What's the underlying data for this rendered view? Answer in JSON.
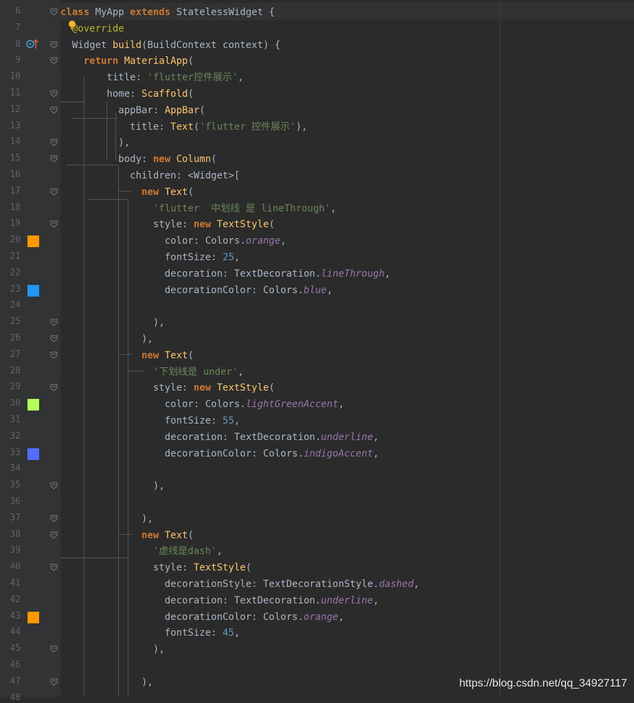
{
  "editor": {
    "lines": [
      {
        "n": "6",
        "tokens": [
          [
            "kw",
            "class "
          ],
          [
            "plain",
            "MyApp "
          ],
          [
            "kw",
            "extends "
          ],
          [
            "plain",
            "StatelessWidget {"
          ]
        ]
      },
      {
        "n": "7",
        "tokens": [
          [
            "anno",
            "  @override"
          ]
        ]
      },
      {
        "n": "8",
        "tokens": [
          [
            "plain",
            "  Widget "
          ],
          [
            "cls",
            "build"
          ],
          [
            "plain",
            "(BuildContext context) {"
          ]
        ]
      },
      {
        "n": "9",
        "tokens": [
          [
            "kw",
            "    return "
          ],
          [
            "cls",
            "MaterialApp"
          ],
          [
            "plain",
            "("
          ]
        ]
      },
      {
        "n": "10",
        "tokens": [
          [
            "plain",
            "        title: "
          ],
          [
            "str",
            "'flutter控件展示'"
          ],
          [
            "plain",
            ","
          ]
        ]
      },
      {
        "n": "11",
        "tokens": [
          [
            "plain",
            "        home: "
          ],
          [
            "cls",
            "Scaffold"
          ],
          [
            "plain",
            "("
          ]
        ]
      },
      {
        "n": "12",
        "tokens": [
          [
            "plain",
            "          appBar: "
          ],
          [
            "cls",
            "AppBar"
          ],
          [
            "plain",
            "("
          ]
        ]
      },
      {
        "n": "13",
        "tokens": [
          [
            "plain",
            "            title: "
          ],
          [
            "cls",
            "Text"
          ],
          [
            "plain",
            "("
          ],
          [
            "str",
            "'flutter 控件展示'"
          ],
          [
            "plain",
            "),"
          ]
        ]
      },
      {
        "n": "14",
        "tokens": [
          [
            "plain",
            "          ),"
          ]
        ]
      },
      {
        "n": "15",
        "tokens": [
          [
            "plain",
            "          body: "
          ],
          [
            "kw",
            "new "
          ],
          [
            "cls",
            "Column"
          ],
          [
            "plain",
            "("
          ]
        ]
      },
      {
        "n": "16",
        "tokens": [
          [
            "plain",
            "            children: <Widget>["
          ]
        ]
      },
      {
        "n": "17",
        "tokens": [
          [
            "kw",
            "              new "
          ],
          [
            "cls",
            "Text"
          ],
          [
            "plain",
            "("
          ]
        ]
      },
      {
        "n": "18",
        "tokens": [
          [
            "str",
            "                'flutter  中划线 是 lineThrough'"
          ],
          [
            "plain",
            ","
          ]
        ]
      },
      {
        "n": "19",
        "tokens": [
          [
            "plain",
            "                style: "
          ],
          [
            "kw",
            "new "
          ],
          [
            "cls",
            "TextStyle"
          ],
          [
            "plain",
            "("
          ]
        ]
      },
      {
        "n": "20",
        "tokens": [
          [
            "plain",
            "                  color: Colors."
          ],
          [
            "field",
            "orange"
          ],
          [
            "plain",
            ","
          ]
        ]
      },
      {
        "n": "21",
        "tokens": [
          [
            "plain",
            "                  fontSize: "
          ],
          [
            "num",
            "25"
          ],
          [
            "plain",
            ","
          ]
        ]
      },
      {
        "n": "22",
        "tokens": [
          [
            "plain",
            "                  decoration: TextDecoration."
          ],
          [
            "field",
            "lineThrough"
          ],
          [
            "plain",
            ","
          ]
        ]
      },
      {
        "n": "23",
        "tokens": [
          [
            "plain",
            "                  decorationColor: Colors."
          ],
          [
            "field",
            "blue"
          ],
          [
            "plain",
            ","
          ]
        ]
      },
      {
        "n": "24",
        "tokens": []
      },
      {
        "n": "25",
        "tokens": [
          [
            "plain",
            "                ),"
          ]
        ]
      },
      {
        "n": "26",
        "tokens": [
          [
            "plain",
            "              ),"
          ]
        ]
      },
      {
        "n": "27",
        "tokens": [
          [
            "kw",
            "              new "
          ],
          [
            "cls",
            "Text"
          ],
          [
            "plain",
            "("
          ]
        ]
      },
      {
        "n": "28",
        "tokens": [
          [
            "str",
            "                '下划线是 under'"
          ],
          [
            "plain",
            ","
          ]
        ]
      },
      {
        "n": "29",
        "tokens": [
          [
            "plain",
            "                style: "
          ],
          [
            "kw",
            "new "
          ],
          [
            "cls",
            "TextStyle"
          ],
          [
            "plain",
            "("
          ]
        ]
      },
      {
        "n": "30",
        "tokens": [
          [
            "plain",
            "                  color: Colors."
          ],
          [
            "field",
            "lightGreenAccent"
          ],
          [
            "plain",
            ","
          ]
        ]
      },
      {
        "n": "31",
        "tokens": [
          [
            "plain",
            "                  fontSize: "
          ],
          [
            "num",
            "55"
          ],
          [
            "plain",
            ","
          ]
        ]
      },
      {
        "n": "32",
        "tokens": [
          [
            "plain",
            "                  decoration: TextDecoration."
          ],
          [
            "field",
            "underline"
          ],
          [
            "plain",
            ","
          ]
        ]
      },
      {
        "n": "33",
        "tokens": [
          [
            "plain",
            "                  decorationColor: Colors."
          ],
          [
            "field",
            "indigoAccent"
          ],
          [
            "plain",
            ","
          ]
        ]
      },
      {
        "n": "34",
        "tokens": []
      },
      {
        "n": "35",
        "tokens": [
          [
            "plain",
            "                ),"
          ]
        ]
      },
      {
        "n": "36",
        "tokens": []
      },
      {
        "n": "37",
        "tokens": [
          [
            "plain",
            "              ),"
          ]
        ]
      },
      {
        "n": "38",
        "tokens": [
          [
            "kw",
            "              new "
          ],
          [
            "cls",
            "Text"
          ],
          [
            "plain",
            "("
          ]
        ]
      },
      {
        "n": "39",
        "tokens": [
          [
            "str",
            "                '虚线是dash'"
          ],
          [
            "plain",
            ","
          ]
        ]
      },
      {
        "n": "40",
        "tokens": [
          [
            "plain",
            "                style: "
          ],
          [
            "cls",
            "TextStyle"
          ],
          [
            "plain",
            "("
          ]
        ]
      },
      {
        "n": "41",
        "tokens": [
          [
            "plain",
            "                  decorationStyle: TextDecorationStyle."
          ],
          [
            "field",
            "dashed"
          ],
          [
            "plain",
            ","
          ]
        ]
      },
      {
        "n": "42",
        "tokens": [
          [
            "plain",
            "                  decoration: TextDecoration."
          ],
          [
            "field",
            "underline"
          ],
          [
            "plain",
            ","
          ]
        ]
      },
      {
        "n": "43",
        "tokens": [
          [
            "plain",
            "                  decorationColor: Colors."
          ],
          [
            "field",
            "orange"
          ],
          [
            "plain",
            ","
          ]
        ]
      },
      {
        "n": "44",
        "tokens": [
          [
            "plain",
            "                  fontSize: "
          ],
          [
            "num",
            "45"
          ],
          [
            "plain",
            ","
          ]
        ]
      },
      {
        "n": "45",
        "tokens": [
          [
            "plain",
            "                ),"
          ]
        ]
      },
      {
        "n": "46",
        "tokens": []
      },
      {
        "n": "47",
        "tokens": [
          [
            "plain",
            "              ),"
          ]
        ]
      },
      {
        "n": "48",
        "tokens": []
      }
    ],
    "swatches": [
      {
        "line_index": 14,
        "color": "#ff9800"
      },
      {
        "line_index": 17,
        "color": "#2196f3"
      },
      {
        "line_index": 24,
        "color": "#b2ff59"
      },
      {
        "line_index": 27,
        "color": "#536dfe"
      },
      {
        "line_index": 37,
        "color": "#ff9800"
      }
    ],
    "fold_markers": [
      0,
      2,
      3,
      5,
      6,
      8,
      9,
      11,
      13,
      19,
      20,
      21,
      23,
      29,
      31,
      32,
      34,
      39,
      41
    ],
    "icons": {
      "bulb": "lightbulb-icon",
      "override": "override-up-arrow-icon"
    }
  },
  "watermark": "https://blog.csdn.net/qq_34927117"
}
